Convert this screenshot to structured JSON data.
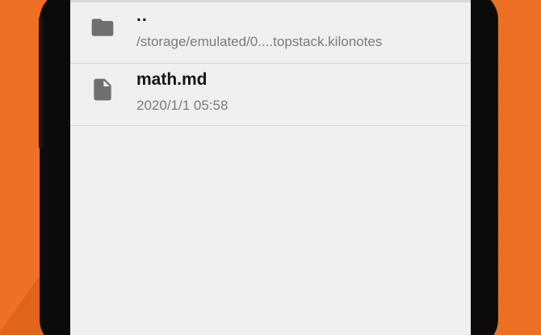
{
  "file_list": {
    "items": [
      {
        "icon": "folder-icon",
        "title": "..",
        "subtitle": "/storage/emulated/0....topstack.kilonotes"
      },
      {
        "icon": "file-icon",
        "title": "math.md",
        "subtitle": "2020/1/1 05:58"
      }
    ]
  },
  "colors": {
    "background": "#ec6a1c",
    "screen": "#efefef",
    "icon": "#6f6f6f",
    "title": "#151515",
    "subtitle": "#7a7a7a"
  }
}
